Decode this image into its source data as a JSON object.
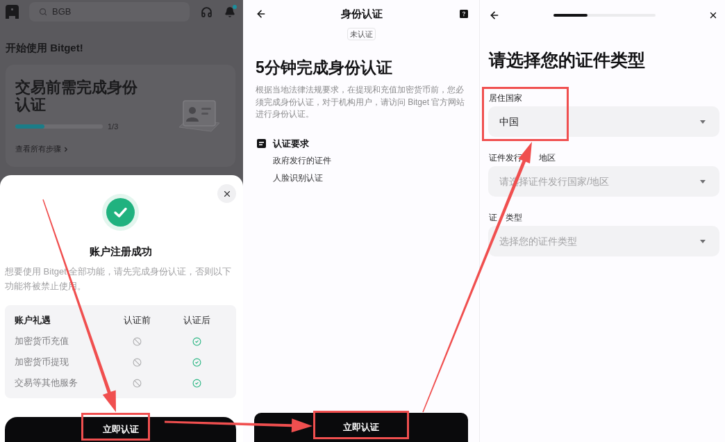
{
  "home": {
    "search": {
      "placeholder": "BGB"
    },
    "notifications": {
      "unread": true
    },
    "greeting": "开始使用 Bitget!",
    "verify_card": {
      "title": "交易前需完成身份认证",
      "progress": {
        "level": 0.33,
        "reading": "1/3"
      },
      "link": "查看所有步骤"
    }
  },
  "success_sheet": {
    "title": "账户注册成功",
    "message": "想要使用 Bitget 全部功能，请先完成身份认证，否则以下功能将被禁止使用。",
    "table": {
      "columns": [
        "账户礼遇",
        "认证前",
        "认证后"
      ],
      "rows": [
        {
          "feature": "加密货币充值",
          "before": false,
          "after": true
        },
        {
          "feature": "加密货币提现",
          "before": false,
          "after": true
        },
        {
          "feature": "交易等其他服务",
          "before": false,
          "after": true
        }
      ]
    },
    "button": {
      "label": "立即认证",
      "highlighted": true
    }
  },
  "identity_screen": {
    "title": "身份认证",
    "status_badge": "未认证",
    "heading": "5分钟完成身份认证",
    "description": "根据当地法律法规要求，在提现和充值加密货币前，您必须完成身份认证，对于机构用户，请访问 Bitget 官方网站进行身份认证。",
    "requirements": {
      "title": "认证要求",
      "items": [
        "政府发行的证件",
        "人脸识别认证"
      ]
    },
    "button": {
      "label": "立即认证",
      "highlighted": true
    }
  },
  "document_screen": {
    "progress": {
      "level": 0.33
    },
    "heading": "请选择您的证件类型",
    "fields": [
      {
        "label": [
          "居住国家"
        ],
        "value": "中国",
        "highlighted": true
      },
      {
        "label": [
          "证件发行",
          "地区"
        ],
        "placeholder": "请选择证件发行国家/地区",
        "highlighted": false
      },
      {
        "label": [
          "证",
          "类型"
        ],
        "placeholder": "选择您的证件类型",
        "highlighted": false
      }
    ]
  }
}
